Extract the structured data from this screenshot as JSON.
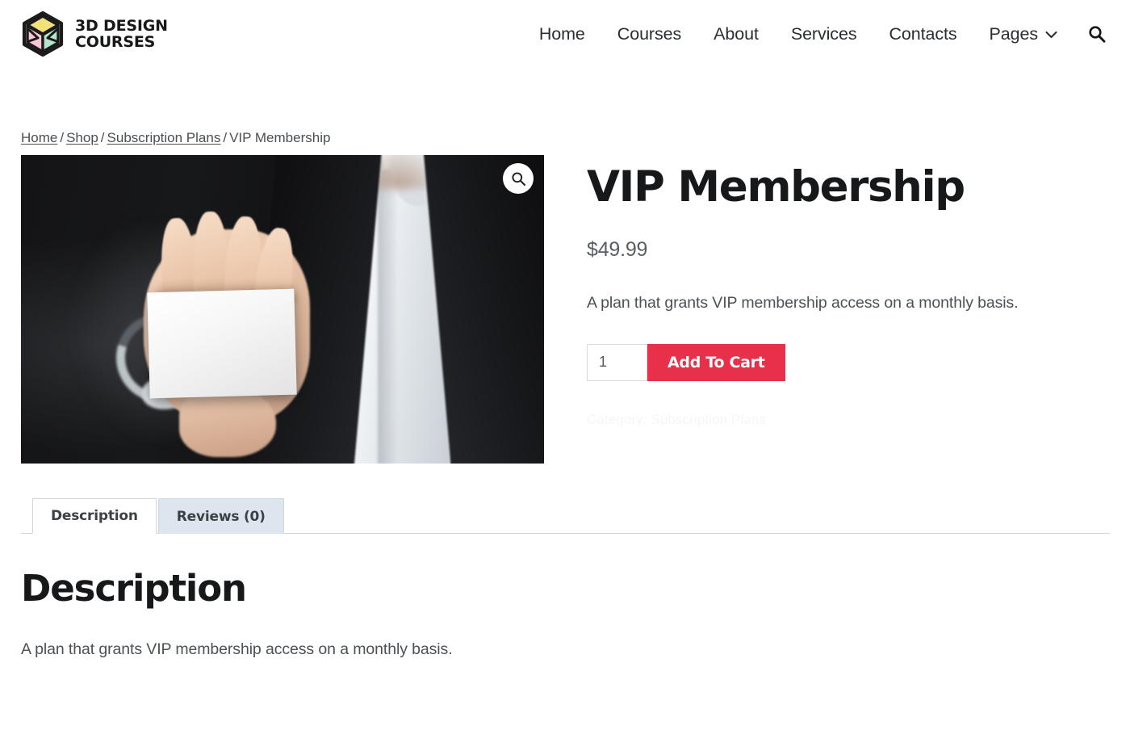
{
  "header": {
    "brand": {
      "logo_icon": "cube-logo-icon",
      "name": "3D DESIGN\nCOURSES",
      "colors": {
        "top": "#f2e17a",
        "left": "#f6c6d4",
        "right": "#b6e5cd",
        "outline": "#1b1b1b"
      }
    },
    "nav": [
      {
        "label": "Home",
        "name": "nav-link-home",
        "has_dropdown": false
      },
      {
        "label": "Courses",
        "name": "nav-link-courses",
        "has_dropdown": false
      },
      {
        "label": "About",
        "name": "nav-link-about",
        "has_dropdown": false
      },
      {
        "label": "Services",
        "name": "nav-link-services",
        "has_dropdown": false
      },
      {
        "label": "Contacts",
        "name": "nav-link-contacts",
        "has_dropdown": false
      },
      {
        "label": "Pages",
        "name": "nav-link-pages",
        "has_dropdown": true
      }
    ],
    "search_icon": "search-icon"
  },
  "breadcrumb": {
    "items": [
      {
        "label": "Home",
        "link": true
      },
      {
        "label": "Shop",
        "link": true
      },
      {
        "label": "Subscription Plans",
        "link": true
      },
      {
        "label": "VIP Membership",
        "link": false
      }
    ],
    "separator": "/"
  },
  "gallery": {
    "zoom_icon": "magnifier-icon",
    "alt": "Man in dark suit holding a blank white business card"
  },
  "product": {
    "title": "VIP Membership",
    "price": "$49.99",
    "short_description": "A plan that grants VIP membership access on a monthly basis.",
    "quantity_value": "1",
    "quantity_placeholder": "1",
    "add_to_cart_label": "Add To Cart",
    "meta_label": "Category:",
    "meta_category": "Subscription Plans",
    "accent_color": "#e8304a"
  },
  "tabs": [
    {
      "label": "Description",
      "active": true
    },
    {
      "label": "Reviews (0)",
      "active": false
    }
  ],
  "description_panel": {
    "heading": "Description",
    "body": "A plan that grants VIP membership access on a monthly basis."
  }
}
